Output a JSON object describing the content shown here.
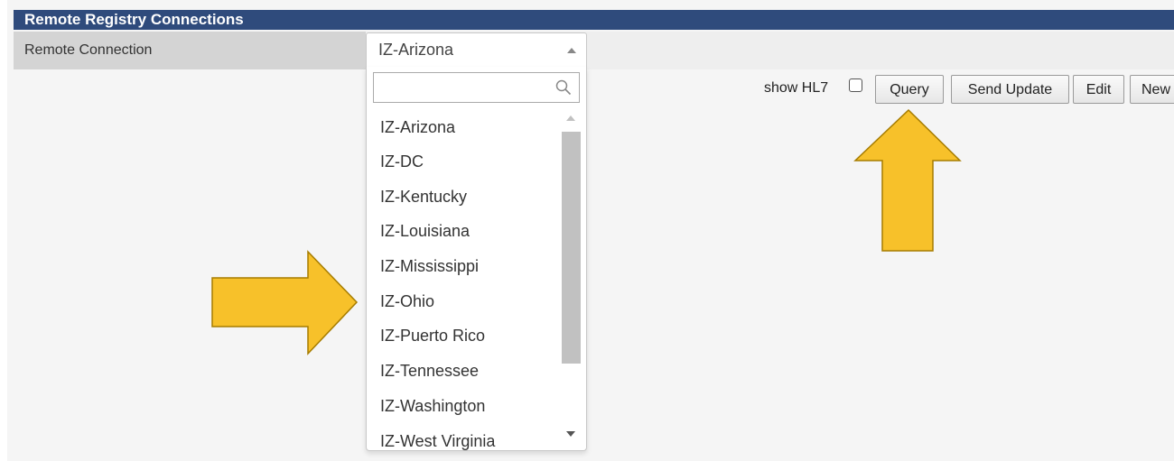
{
  "header": {
    "title": "Remote Registry Connections"
  },
  "connection": {
    "label": "Remote Connection",
    "selected": "IZ-Arizona",
    "search_value": "",
    "options": [
      "IZ-Arizona",
      "IZ-DC",
      "IZ-Kentucky",
      "IZ-Louisiana",
      "IZ-Mississippi",
      "IZ-Ohio",
      "IZ-Puerto Rico",
      "IZ-Tennessee",
      "IZ-Washington",
      "IZ-West Virginia"
    ]
  },
  "toolbar": {
    "show_hl7_label": "show HL7",
    "show_hl7_checked": false,
    "query_label": "Query",
    "send_update_label": "Send Update",
    "edit_label": "Edit",
    "new_label": "New"
  },
  "icons": {
    "search": "search-icon",
    "annotation": "arrow-icon"
  },
  "colors": {
    "title_bar": "#2f4b7c",
    "annotation_arrow": "#f7c12a",
    "annotation_outline": "#a67c00"
  }
}
